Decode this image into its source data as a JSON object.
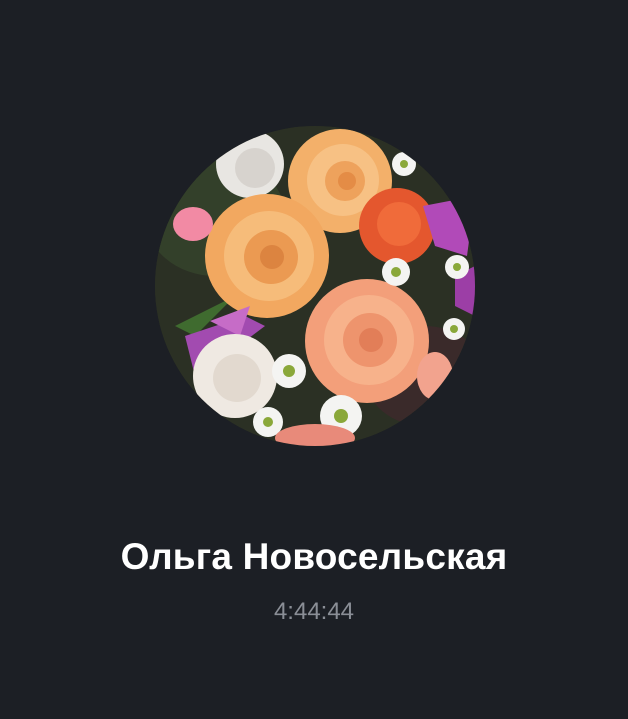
{
  "call": {
    "caller_name": "Ольга Новосельская",
    "duration": "4:44:44"
  },
  "avatar": {
    "icon": "flower-bouquet-photo"
  },
  "colors": {
    "background": "#1c1f25",
    "name_text": "#ffffff",
    "timer_text": "#8a8e96"
  }
}
